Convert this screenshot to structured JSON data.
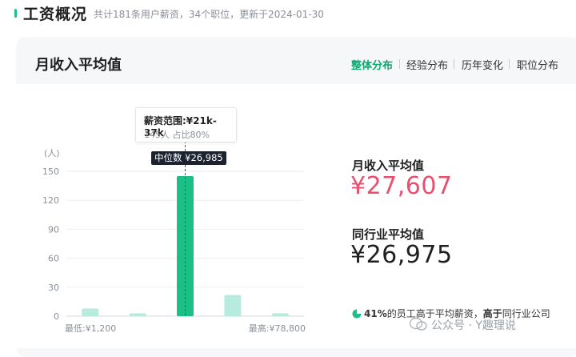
{
  "header": {
    "title": "工资概况",
    "subtitle": "共计181条用户薪资，34个职位，更新于2024-01-30",
    "accent_color": "#21c18a"
  },
  "card": {
    "title": "月收入平均值",
    "tabs": [
      {
        "label": "整体分布",
        "active": true
      },
      {
        "label": "经验分布",
        "active": false
      },
      {
        "label": "历年变化",
        "active": false
      },
      {
        "label": "职位分布",
        "active": false
      }
    ]
  },
  "tooltip": {
    "title": "薪资范围:¥21k-37k",
    "detail": "145人  占比80%"
  },
  "median_label": "中位数 ¥26,985",
  "chart_data": {
    "type": "bar",
    "y_unit_label": "(人)",
    "ylim": [
      0,
      150
    ],
    "y_ticks": [
      "0",
      "30",
      "60",
      "90",
      "120",
      "150"
    ],
    "values": [
      8,
      3,
      145,
      22,
      3
    ],
    "highlight_index": 2,
    "colors": {
      "bar": "#b7ebdd",
      "highlight": "#1cbf86"
    },
    "x_min_label": "最低:¥1,200",
    "x_max_label": "最高:¥78,800"
  },
  "stats": {
    "avg_label": "月收入平均值",
    "avg_value": "¥27,607",
    "avg_color": "#e8506f",
    "industry_label": "同行业平均值",
    "industry_value": "¥26,975",
    "industry_color": "#1f1f1f"
  },
  "footnote": {
    "percent": "41%",
    "text1": "的员工高于平均薪资，",
    "bold2": "高于",
    "text2": "同行业公司"
  },
  "watermark": "公众号 · Y趣理说"
}
